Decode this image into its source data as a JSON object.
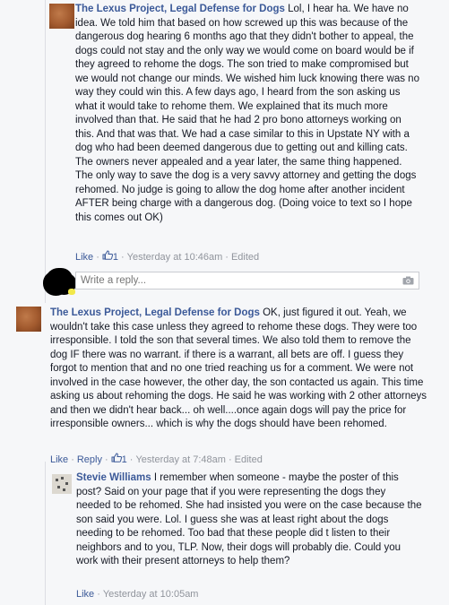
{
  "comments": [
    {
      "author": "The Lexus Project, Legal Defense for Dogs",
      "text": " Lol, I hear ha. We have no idea. We told him that based on how screwed up this was because of the dangerous dog hearing 6 months ago that they didn't bother to appeal, the dogs could not stay and the only way we would come on board would be if they agreed to rehome the dogs. The son tried to make compromised but we would not change our minds. We wished him luck knowing there was no way they could win this. A few days ago, I heard from the son asking us what it would take to rehome them. We explained that its much more involved than that. He said that he had 2 pro bono attorneys working on this. And that was that. We had a case similar to this in Upstate NY with a dog who had been deemed dangerous due to getting out and killing cats. The owners never appealed and a year later, the same thing happened. The only way to save the dog is a very savvy attorney and getting the dogs rehomed. No judge is going to allow the dog home after another incident AFTER being charge with a dangerous dog. (Doing voice to text so I hope this comes out OK)",
      "like_label": "Like",
      "like_count": "1",
      "timestamp": "Yesterday at 10:46am",
      "edited": "Edited"
    },
    {
      "author": "The Lexus Project, Legal Defense for Dogs",
      "text": " OK, just figured it out. Yeah, we wouldn't take this case unless they agreed to rehome these dogs. They were too irresponsible. I told the son that several times. We also told them to remove the dog IF there was no warrant. if there is a warrant, all bets are off. I guess they forgot to mention that and no one tried reaching us for a comment. We were not involved in the case however, the other day, the son contacted us again. This time asking us about rehoming the dogs. He said he was working with 2 other attorneys and then we didn't hear back... oh well....once again dogs will pay the price for irresponsible owners... which is why the dogs should have been rehomed.",
      "like_label": "Like",
      "reply_label": "Reply",
      "like_count": "1",
      "timestamp": "Yesterday at 7:48am",
      "edited": "Edited"
    },
    {
      "author": "Stevie Williams",
      "text": " I remember when someone - maybe the poster of this post? Said on your page that if you were representing the dogs they needed to be rehomed. She had insisted you were on the case because the son said you were. Lol. I guess she was at least right about the dogs needing to be rehomed. Too bad that these people did t listen to their neighbors and to you, TLP. Now, their dogs will probably die. Could you work with their present attorneys to help them?",
      "like_label": "Like",
      "timestamp": "Yesterday at 10:05am"
    }
  ],
  "reply_box": {
    "placeholder": "Write a reply..."
  },
  "icons": {
    "like": "thumbs-up-icon",
    "camera": "camera-icon"
  },
  "colors": {
    "link": "#3b5998",
    "meta": "#90949c",
    "background": "#f6f7f9"
  }
}
